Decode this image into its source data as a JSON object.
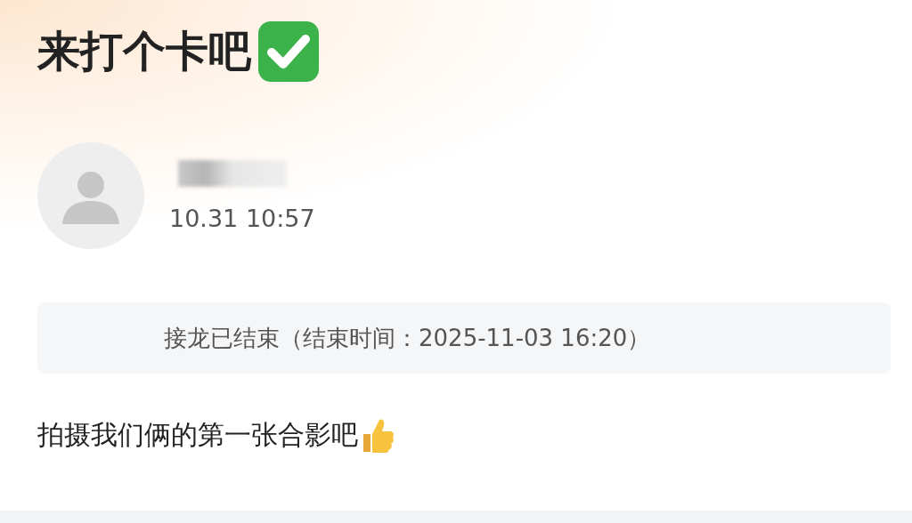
{
  "post": {
    "title": "来打个卡吧"
  },
  "author": {
    "time": "10.31 10:57"
  },
  "status_banner": {
    "text": "接龙已结束（结束时间：2025-11-03 16:20）"
  },
  "message": {
    "text": "拍摄我们俩的第一张合影吧"
  }
}
